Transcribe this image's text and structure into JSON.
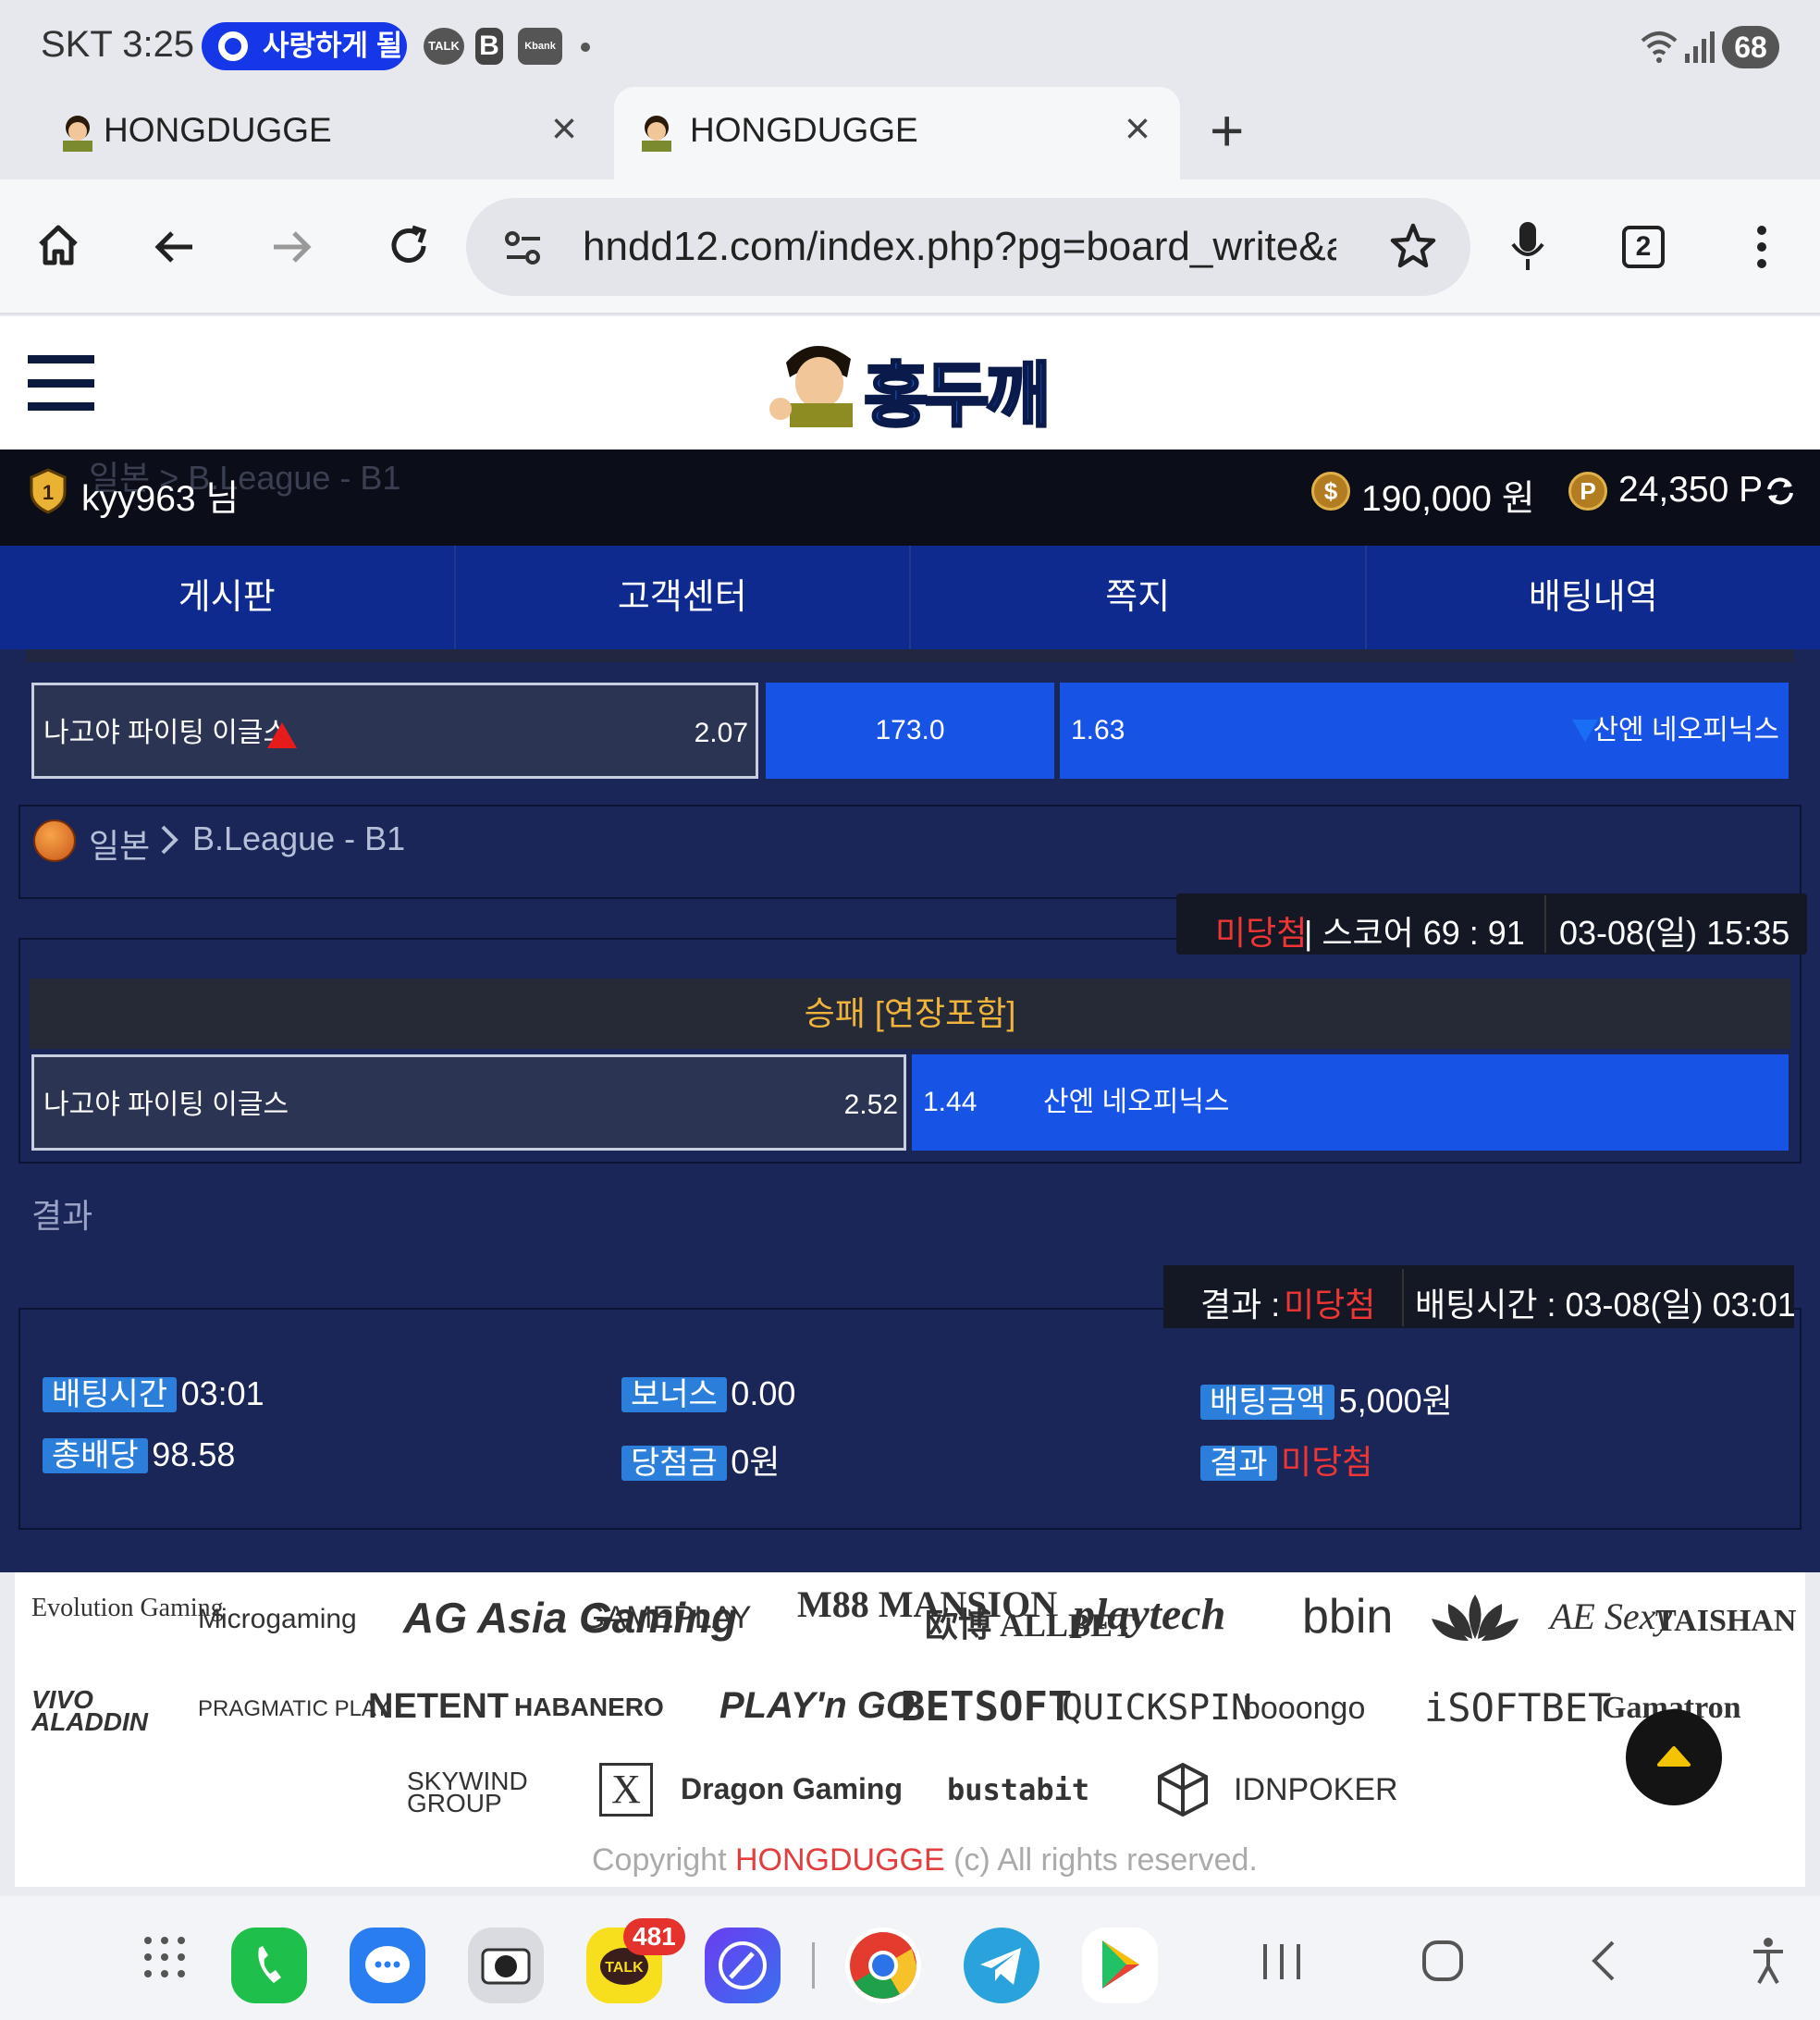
{
  "status_bar": {
    "carrier": "SKT",
    "time": "3:25",
    "notification_pill": "사랑하게 될",
    "battery": "68"
  },
  "tabs": [
    {
      "title": "HONGDUGGE",
      "active": false
    },
    {
      "title": "HONGDUGGE",
      "active": true
    }
  ],
  "toolbar": {
    "url": "hndd12.com/index.php?pg=board_write&ac",
    "tab_count": "2"
  },
  "site": {
    "logo_text": "홍두깨",
    "user": {
      "name": "kyy963 님",
      "money": "190,000 원",
      "points": "24,350 P"
    },
    "nav": [
      "게시판",
      "고객센터",
      "쪽지",
      "배팅내역"
    ],
    "ghost_text": "일본 > B.League - B1"
  },
  "bet1": {
    "home": "나고야 파이팅 이글스",
    "home_odds": "2.07",
    "line": "173.0",
    "away_odds": "1.63",
    "away": "산엔 네오피닉스"
  },
  "bet2": {
    "country": "일본",
    "league": "B.League - B1",
    "status": "미당첨",
    "score": "| 스코어 69 : 91",
    "date": "03-08(일) 15:35",
    "market": "승패 [연장포함]",
    "home": "나고야 파이팅 이글스",
    "home_odds": "2.52",
    "away_odds": "1.44",
    "away": "산엔 네오피닉스"
  },
  "result_section": {
    "label": "결과",
    "result_key": "결과 :",
    "result_value": "미당첨",
    "bet_time_full": "배팅시간 : 03-08(일) 03:01"
  },
  "summary": {
    "bet_time_label": "배팅시간",
    "bet_time": "03:01",
    "bonus_label": "보너스",
    "bonus": "0.00",
    "bet_amount_label": "배팅금액",
    "bet_amount": "5,000원",
    "total_odds_label": "총배당",
    "total_odds": "98.58",
    "win_amount_label": "당첨금",
    "win_amount": "0원",
    "result_label": "결과",
    "result": "미당첨"
  },
  "providers": {
    "row1": [
      "Evolution Gaming",
      "Microgaming",
      "AG Asia Gaming",
      "GAMEPLAY",
      "M88 MANSION",
      "欧博 ALLBET",
      "playtech",
      "bbin",
      "Lotus",
      "AE Sexy",
      "TAISHAN"
    ],
    "row2": [
      "VIVO ALADDIN",
      "PRAGMATIC PLAY",
      "NETENT",
      "HABANERO",
      "PLAY'n GO",
      "BETSOFT",
      "QUICKSPIN",
      "booongo",
      "iSOFTBET",
      "Gamatron"
    ],
    "row3": [
      "SKYWIND GROUP",
      "X",
      "Dragon Gaming",
      "bustabit",
      "",
      "IDNPOKER"
    ]
  },
  "copyright": {
    "prefix": "Copyright ",
    "brand": "HONGDUGGE",
    "suffix": " (c) All rights reserved."
  },
  "android_bar": {
    "talk_badge": "481"
  },
  "colors": {
    "navy": "#1a2558",
    "nav_blue": "#0e2a8e",
    "odds_blue": "#1754e6",
    "lost_red": "#f03535",
    "market_gold": "#f0b43a"
  }
}
